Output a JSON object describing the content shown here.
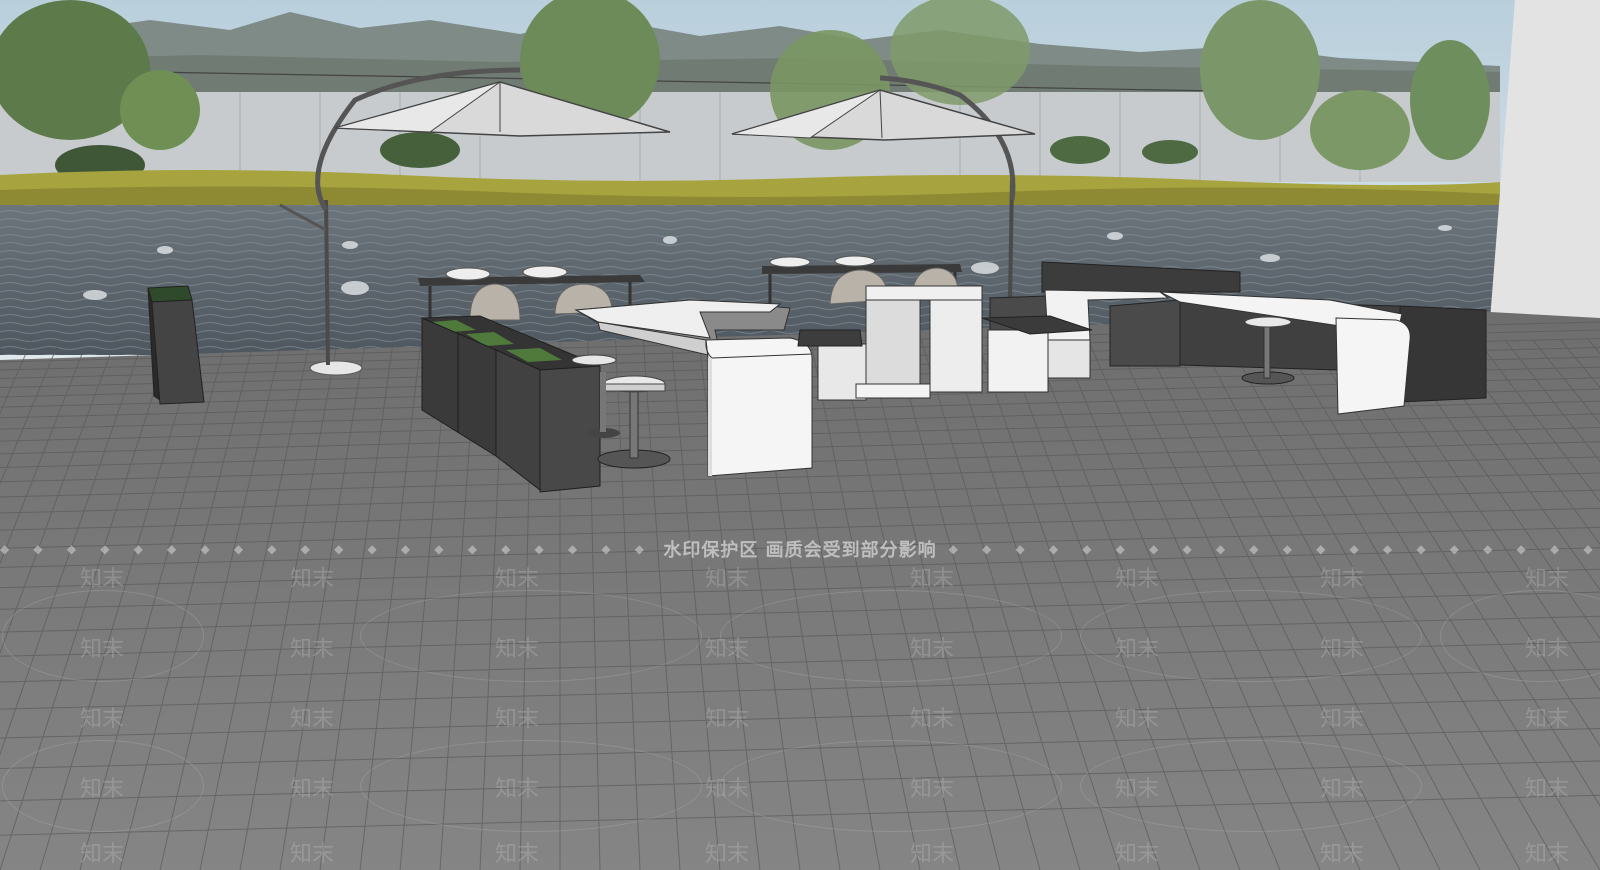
{
  "watermark": {
    "banner_text": "水印保护区   画质会受到部分影响",
    "banner_dots": "◆ ◆ ◆ ◆ ◆ ◆ ◆ ◆ ◆ ◆ ◆ ◆ ◆ ◆ ◆ ◆ ◆ ◆ ◆ ◆ ◆ ◆ ◆ ◆ ◆ ◆",
    "tile_text": "知末"
  },
  "colors": {
    "sky": "#c9dbe6",
    "mountains": "#7d8a86",
    "wall": "#c8ccce",
    "water": "#5d6770",
    "lawn": "#9a9a3a",
    "floor": "#7b7b7b",
    "planter_dark": "#3d3d3d",
    "counter_white": "#f2f2f2",
    "umbrella": "#d9d9d9"
  }
}
